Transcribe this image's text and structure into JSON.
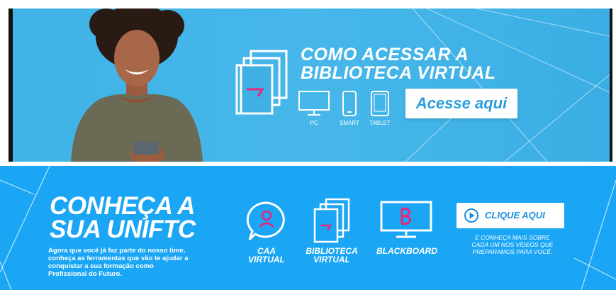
{
  "banner_top": {
    "title_line1": "COMO ACESSAR A",
    "title_line2": "BIBLIOTECA VIRTUAL",
    "devices": [
      {
        "label": "PC",
        "icon": "monitor-icon"
      },
      {
        "label": "SMART",
        "icon": "smartphone-icon"
      },
      {
        "label": "TABLET",
        "icon": "tablet-icon"
      }
    ],
    "button_label": "Acesse aqui",
    "colors": {
      "background": "#45b5e8",
      "button_text": "#2a9fdc",
      "book_accent": "#e6267a"
    }
  },
  "banner_bottom": {
    "title_line1": "CONHEÇA A",
    "title_line2": "SUA UNIFTC",
    "subtitle_lines": [
      "Agora que você já faz parte do nosso time,",
      "conheça as ferramentas que vão te ajudar a",
      "conquistar a sua formação como",
      "Profissional do Futuro."
    ],
    "tools": [
      {
        "label_line1": "CAA",
        "label_line2": "VIRTUAL",
        "icon": "chat-user-icon"
      },
      {
        "label_line1": "BIBLIOTECA",
        "label_line2": "VIRTUAL",
        "icon": "books-icon"
      },
      {
        "label_line1": "BLACKBOARD",
        "label_line2": "",
        "icon": "blackboard-monitor-icon"
      }
    ],
    "cta_label": "CLIQUE AQUI",
    "cta_note_lines": [
      "E CONHEÇA MAIS SOBRE",
      "CADA UM NOS VÍDEOS QUE",
      "PREPARAMOS PARA VOCÊ."
    ],
    "colors": {
      "background": "#1aa6f4",
      "accent": "#e6267a"
    }
  }
}
